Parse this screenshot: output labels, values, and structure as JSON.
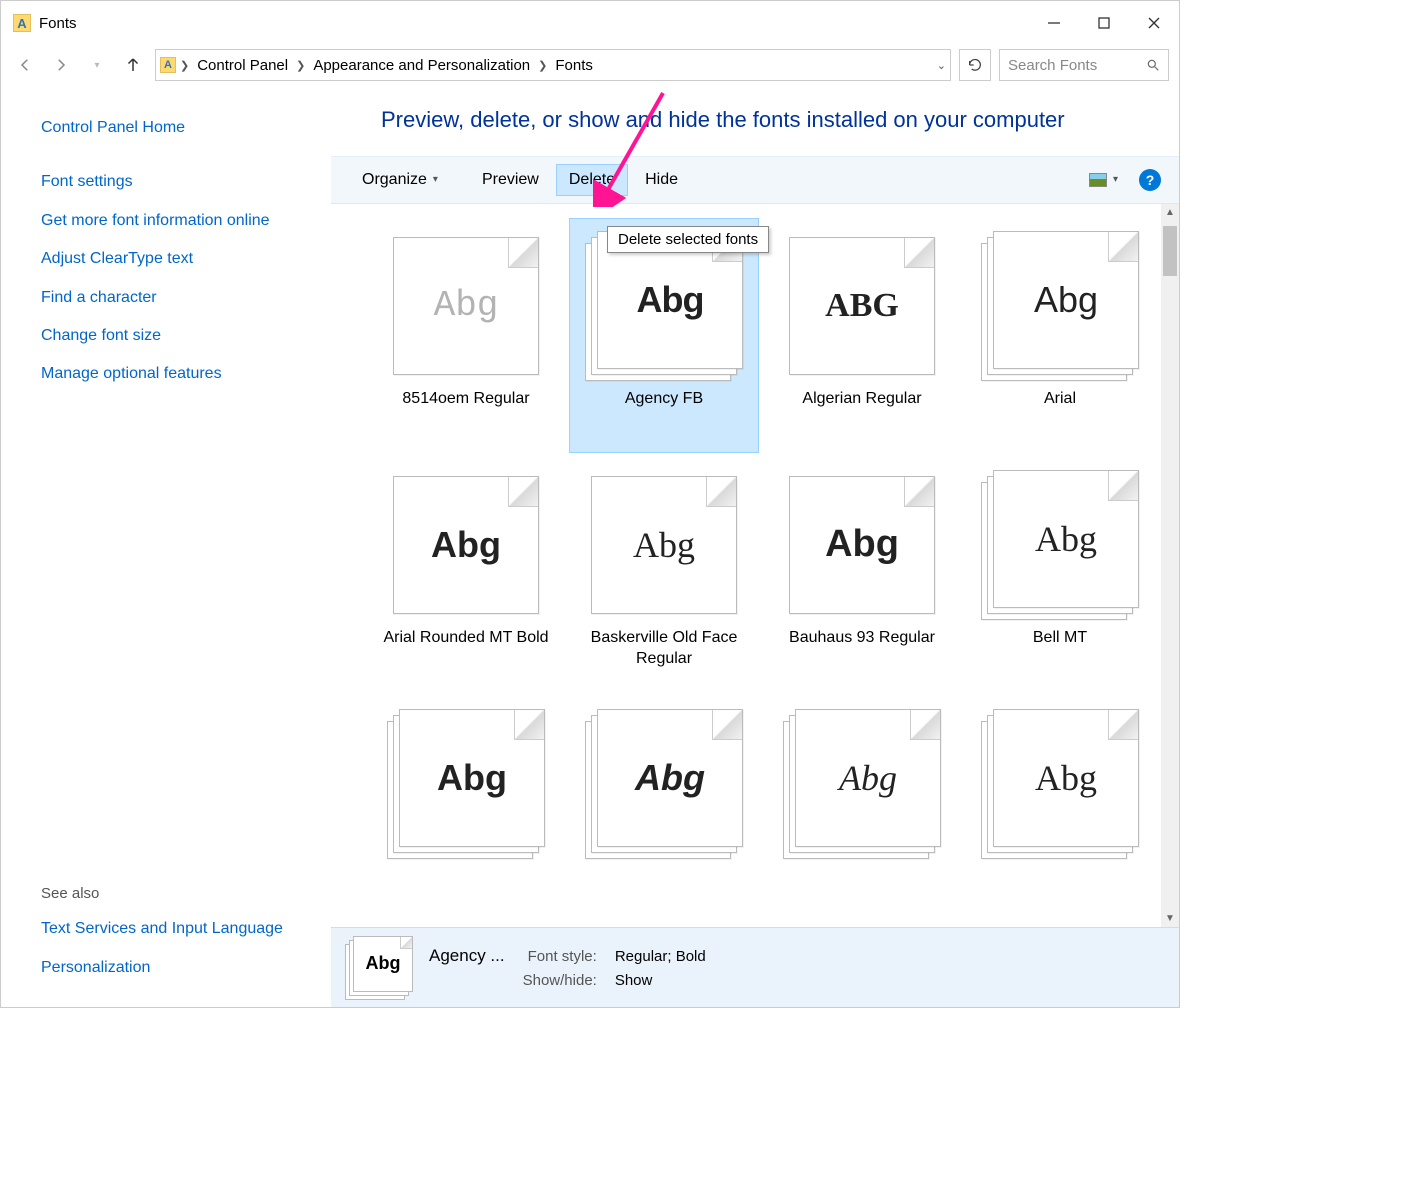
{
  "window": {
    "title": "Fonts"
  },
  "breadcrumb": {
    "items": [
      "Control Panel",
      "Appearance and Personalization",
      "Fonts"
    ]
  },
  "search": {
    "placeholder": "Search Fonts"
  },
  "sidebar": {
    "home": "Control Panel Home",
    "links": [
      "Font settings",
      "Get more font information online",
      "Adjust ClearType text",
      "Find a character",
      "Change font size",
      "Manage optional features"
    ],
    "seealso_header": "See also",
    "seealso": [
      "Text Services and Input Language",
      "Personalization"
    ]
  },
  "heading": "Preview, delete, or show and hide the fonts installed on your computer",
  "toolbar": {
    "organize": "Organize",
    "preview": "Preview",
    "delete": "Delete",
    "hide": "Hide",
    "help_tooltip": "?"
  },
  "tooltip": "Delete selected fonts",
  "fonts": [
    {
      "name": "8514oem Regular",
      "sample": "Abg",
      "stack": false,
      "style": "font-family:Courier,monospace;color:#b3b3b3;font-weight:normal"
    },
    {
      "name": "Agency FB",
      "sample": "Abg",
      "stack": true,
      "style": "font-family:'Agency FB','Segoe UI Condensed',sans-serif;letter-spacing:-1px",
      "selected": true
    },
    {
      "name": "Algerian Regular",
      "sample": "ABG",
      "stack": false,
      "style": "font-family:'Algerian',serif;font-weight:bold;font-size:34px"
    },
    {
      "name": "Arial",
      "sample": "Abg",
      "stack": true,
      "style": "font-family:Arial,sans-serif;font-weight:normal"
    },
    {
      "name": "Arial Rounded MT Bold",
      "sample": "Abg",
      "stack": false,
      "style": "font-family:'Arial Rounded MT Bold','Arial Black',sans-serif;font-weight:900"
    },
    {
      "name": "Baskerville Old Face Regular",
      "sample": "Abg",
      "stack": false,
      "style": "font-family:'Baskerville Old Face','Times New Roman',serif;font-weight:normal"
    },
    {
      "name": "Bauhaus 93 Regular",
      "sample": "Abg",
      "stack": false,
      "style": "font-family:'Bauhaus 93','Arial Black',sans-serif;font-weight:900;font-size:38px"
    },
    {
      "name": "Bell MT",
      "sample": "Abg",
      "stack": true,
      "style": "font-family:'Bell MT','Times New Roman',serif;font-weight:normal"
    },
    {
      "name": "",
      "sample": "Abg",
      "stack": true,
      "style": "font-family:'Arial Black',sans-serif;font-weight:900"
    },
    {
      "name": "",
      "sample": "Abg",
      "stack": true,
      "style": "font-family:Impact,'Segoe UI',sans-serif;font-weight:bold;font-style:italic"
    },
    {
      "name": "",
      "sample": "Abg",
      "stack": true,
      "style": "font-family:'Brush Script MT',cursive;font-style:italic;font-weight:normal"
    },
    {
      "name": "",
      "sample": "Abg",
      "stack": true,
      "style": "font-family:'Bodoni MT','Times New Roman',serif;font-weight:normal"
    }
  ],
  "details": {
    "name": "Agency ...",
    "sample": "Abg",
    "labels": {
      "fontstyle": "Font style:",
      "showhide": "Show/hide:"
    },
    "values": {
      "fontstyle": "Regular; Bold",
      "showhide": "Show"
    }
  }
}
